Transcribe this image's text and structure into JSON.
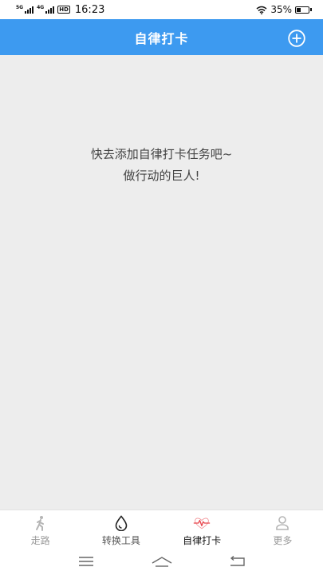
{
  "status_bar": {
    "sim1_tag": "5G",
    "sim2_tag": "4G",
    "hd_tag": "HD",
    "time": "16:23",
    "battery_text": "35%",
    "battery_level": 0.35
  },
  "header": {
    "title": "自律打卡",
    "add_icon": "plus-circle-icon"
  },
  "empty_state": {
    "line1": "快去添加自律打卡任务吧~",
    "line2": "做行动的巨人!"
  },
  "tabs": [
    {
      "label": "走路",
      "icon": "walking-person-icon",
      "active": false
    },
    {
      "label": "转换工具",
      "icon": "water-drop-icon",
      "active": false
    },
    {
      "label": "自律打卡",
      "icon": "heartbeat-icon",
      "active": true
    },
    {
      "label": "更多",
      "icon": "person-outline-icon",
      "active": false
    }
  ],
  "nav_bar": {
    "menu_icon": "menu-icon",
    "home_icon": "home-icon",
    "back_icon": "back-icon"
  },
  "colors": {
    "header_bg": "#3d9af0",
    "page_bg": "#ededed",
    "active_icon": "#e8474f",
    "inactive_text": "#9a9a9a"
  }
}
